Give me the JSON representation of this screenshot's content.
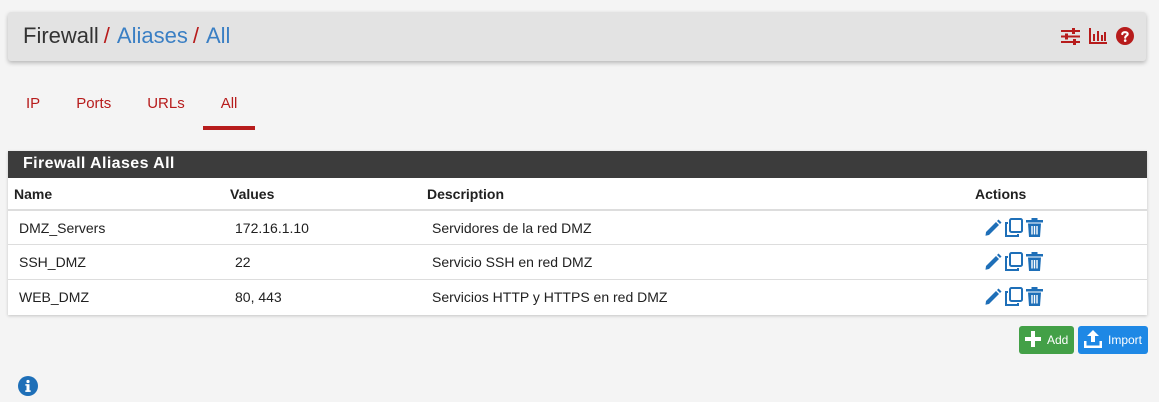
{
  "breadcrumb": {
    "root": "Firewall",
    "sep": "/",
    "section": "Aliases",
    "current": "All"
  },
  "header_icons": [
    "sliders-icon",
    "chart-icon",
    "help-icon"
  ],
  "tabs": [
    {
      "label": "IP",
      "active": false
    },
    {
      "label": "Ports",
      "active": false
    },
    {
      "label": "URLs",
      "active": false
    },
    {
      "label": "All",
      "active": true
    }
  ],
  "panel": {
    "title": "Firewall Aliases All",
    "columns": {
      "name": "Name",
      "values": "Values",
      "description": "Description",
      "actions": "Actions"
    },
    "rows": [
      {
        "name": "DMZ_Servers",
        "values": "172.16.1.10",
        "description": "Servidores de la red DMZ"
      },
      {
        "name": "SSH_DMZ",
        "values": "22",
        "description": "Servicio SSH en red DMZ"
      },
      {
        "name": "WEB_DMZ",
        "values": "80, 443",
        "description": "Servicios HTTP y HTTPS en red DMZ"
      }
    ]
  },
  "buttons": {
    "add": "Add",
    "import": "Import"
  },
  "colors": {
    "accent_red": "#b71c1c",
    "link_blue": "#3a7fc4",
    "add_green": "#43a047",
    "import_blue": "#1e88e5",
    "heading_dark": "#3c3c3c"
  }
}
